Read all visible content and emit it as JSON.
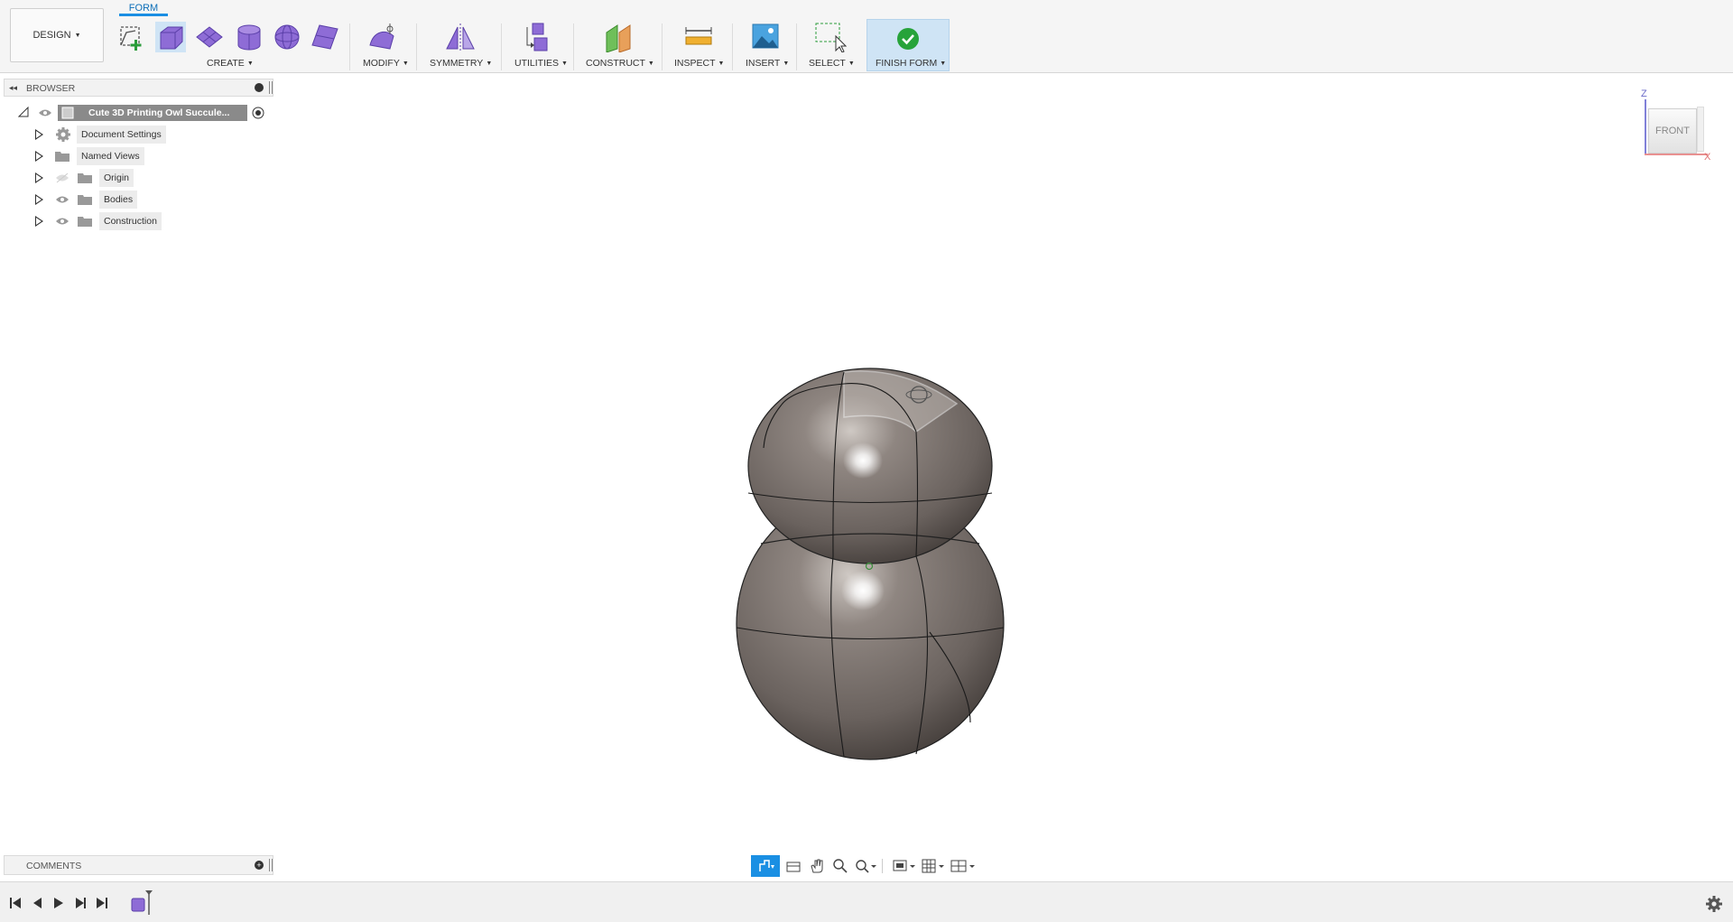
{
  "workspace": {
    "label": "DESIGN"
  },
  "tab": {
    "active": "FORM"
  },
  "toolbar": {
    "groups": {
      "create": "CREATE",
      "modify": "MODIFY",
      "symmetry": "SYMMETRY",
      "utilities": "UTILITIES",
      "construct": "CONSTRUCT",
      "inspect": "INSPECT",
      "insert": "INSERT",
      "select": "SELECT",
      "finish": "FINISH FORM"
    }
  },
  "browser": {
    "title": "BROWSER",
    "root": "Cute 3D Printing Owl Succule...",
    "items": [
      {
        "label": "Document Settings",
        "icon": "gear-icon"
      },
      {
        "label": "Named Views",
        "icon": "folder-icon"
      },
      {
        "label": "Origin",
        "icon": "folder-icon"
      },
      {
        "label": "Bodies",
        "icon": "folder-icon"
      },
      {
        "label": "Construction",
        "icon": "folder-icon"
      }
    ]
  },
  "viewcube": {
    "face": "FRONT",
    "axis_z": "Z",
    "axis_x": "X"
  },
  "comments": {
    "title": "COMMENTS"
  },
  "colors": {
    "accent": "#1a8fe3",
    "finish_bg": "#cfe4f5",
    "body": "#7a716c"
  }
}
